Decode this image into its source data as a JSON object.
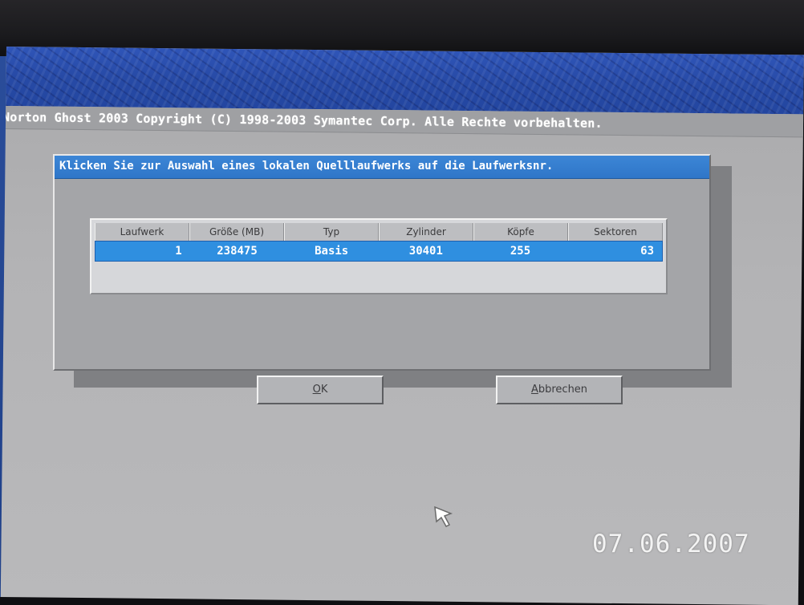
{
  "app": {
    "title_line": "Norton Ghost 2003   Copyright (C) 1998-2003 Symantec Corp. Alle Rechte vorbehalten."
  },
  "dialog": {
    "title": "Klicken Sie zur Auswahl eines lokalen Quelllaufwerks auf die Laufwerksnr.",
    "table": {
      "columns": [
        "Laufwerk",
        "Größe (MB)",
        "Typ",
        "Zylinder",
        "Köpfe",
        "Sektoren"
      ],
      "rows": [
        {
          "laufwerk": "1",
          "groesse": "238475",
          "typ": "Basis",
          "zylinder": "30401",
          "koepfe": "255",
          "sektoren": "63"
        }
      ]
    },
    "buttons": {
      "ok_mnemonic": "O",
      "ok_rest": "K",
      "cancel_mnemonic": "A",
      "cancel_rest": "bbrechen"
    }
  },
  "overlay": {
    "date_stamp": "07.06.2007"
  },
  "colors": {
    "titlebar": "#2f76c8",
    "selected_row": "#2f8fe0",
    "dialog_bg": "#a4a5a8",
    "banner": "#274aa6"
  },
  "icons": {
    "cursor": "mouse-pointer-icon"
  }
}
